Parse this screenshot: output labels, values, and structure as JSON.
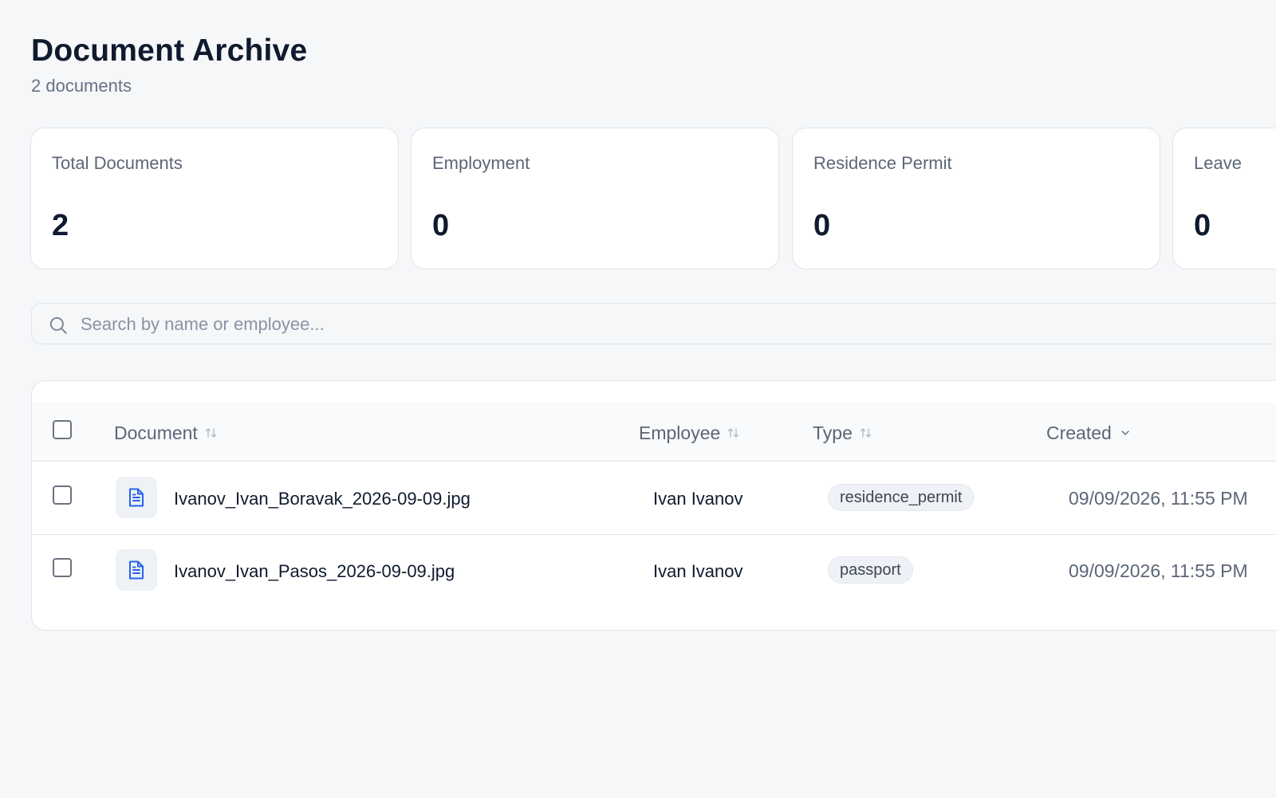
{
  "header": {
    "title": "Document Archive",
    "subtitle": "2 documents"
  },
  "stats": [
    {
      "label": "Total Documents",
      "value": "2"
    },
    {
      "label": "Employment",
      "value": "0"
    },
    {
      "label": "Residence Permit",
      "value": "0"
    },
    {
      "label": "Leave",
      "value": "0"
    }
  ],
  "search": {
    "placeholder": "Search by name or employee...",
    "value": ""
  },
  "table": {
    "columns": {
      "document": "Document",
      "employee": "Employee",
      "type": "Type",
      "created": "Created"
    },
    "rows": [
      {
        "document": "Ivanov_Ivan_Boravak_2026-09-09.jpg",
        "employee": "Ivan Ivanov",
        "type": "residence_permit",
        "created": "09/09/2026, 11:55 PM"
      },
      {
        "document": "Ivanov_Ivan_Pasos_2026-09-09.jpg",
        "employee": "Ivan Ivanov",
        "type": "passport",
        "created": "09/09/2026, 11:55 PM"
      }
    ]
  },
  "icons": {
    "search": "search-icon",
    "sort": "sort-arrows-icon",
    "sort_active": "chevron-down-icon",
    "file": "file-text-icon"
  },
  "colors": {
    "background": "#f5f7f9",
    "file_icon": "#2563eb",
    "text_primary": "#0f1a2e",
    "text_muted": "#5c6677"
  }
}
